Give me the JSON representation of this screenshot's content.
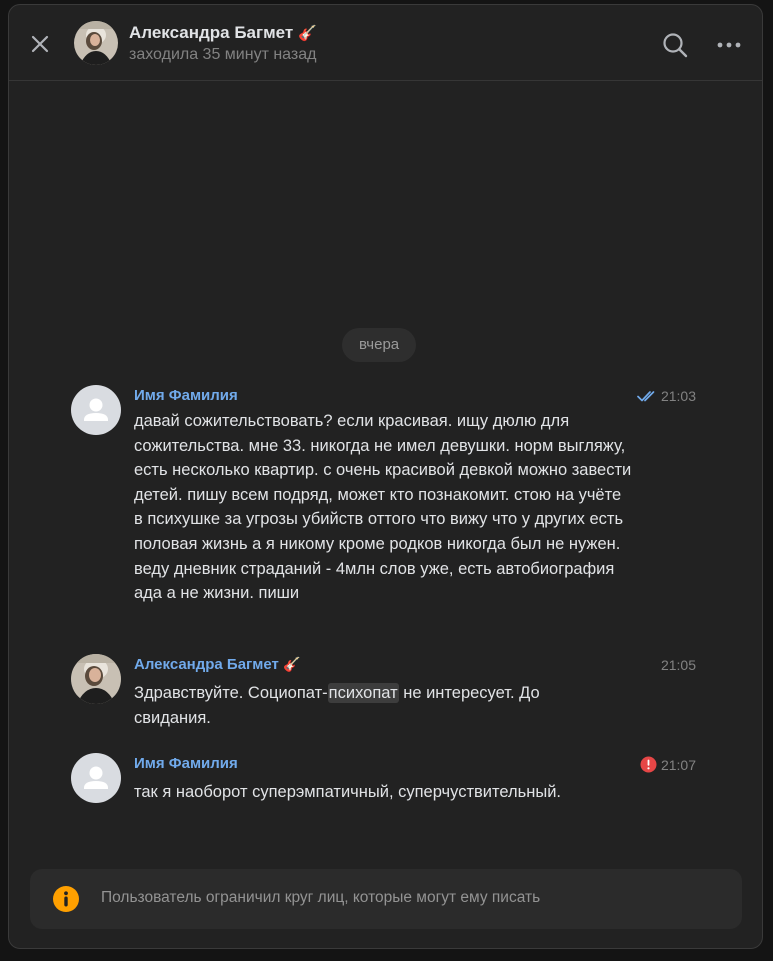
{
  "header": {
    "name": "Александра Багмет",
    "name_emoji": "🎸",
    "status": "заходила 35 минут назад"
  },
  "date_separator": "вчера",
  "messages": [
    {
      "author": "Имя Фамилия",
      "text": "давай сожительствовать? если красивая. ищу дюлю для сожительства. мне 33. никогда не имел девушки. норм выгляжу, есть несколько квартир. с очень красивой девкой можно завести детей. пишу всем подряд, может кто познакомит. стою на учёте в психушке за угрозы убийств оттого что вижу что у других есть половая жизнь а я никому кроме родков никогда был не нужен. веду дневник страданий - 4млн слов уже, есть автобиография ада а не жизни. пиши",
      "time": "21:03",
      "status": "read"
    },
    {
      "author": "Александра Багмет",
      "author_emoji": "🎸",
      "text_before": "Здравствуйте. Социопат-",
      "text_highlight": "психопат",
      "text_after": " не интересует. До свидания.",
      "time": "21:05"
    },
    {
      "author": "Имя Фамилия",
      "text": "так я наоборот суперэмпатичный, суперчуствительный.",
      "time": "21:07",
      "status": "error"
    }
  ],
  "notice": {
    "text": "Пользователь ограничил круг лиц, которые могут ему писать"
  },
  "colors": {
    "accent_link": "#71aaeb",
    "error": "#e64646",
    "warning": "#ffa000",
    "read_check": "#71aaeb"
  },
  "icons": {
    "close": "close-icon",
    "search": "search-icon",
    "more": "more-icon",
    "read": "double-check-icon",
    "error": "error-icon",
    "info": "info-icon"
  }
}
